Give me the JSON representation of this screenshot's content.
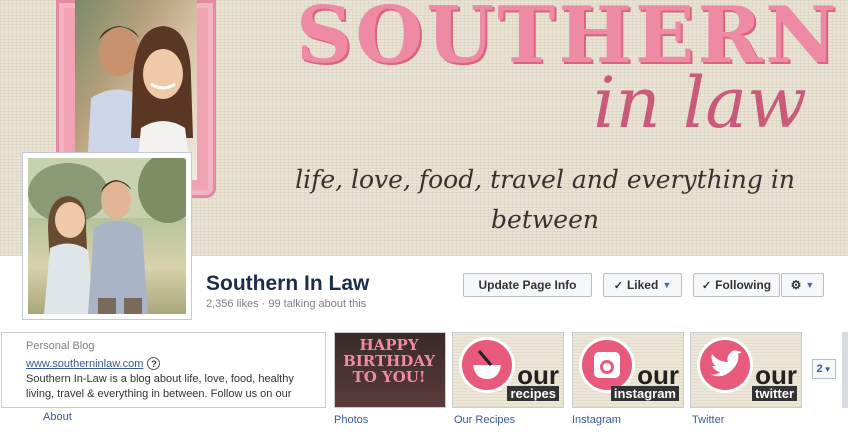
{
  "cover": {
    "title_big": "SOUTHERN",
    "title_small": "in law",
    "tagline": "life, love, food, travel and everything in between",
    "colors": {
      "pink": "#ee8aa3",
      "dark_pink": "#c95a7a",
      "linen": "#e9e3d3"
    }
  },
  "page": {
    "name": "Southern In Law",
    "stats": "2,356 likes · 99 talking about this"
  },
  "actions": {
    "update": "Update Page Info",
    "liked": "Liked",
    "following": "Following",
    "gear_icon": "gear-icon",
    "caret_icon": "caret-down-icon",
    "check_icon": "check-icon"
  },
  "about": {
    "category": "Personal Blog",
    "website": "www.southerninlaw.com",
    "help": "?",
    "description": "Southern In-Law is a blog about life, love, food, healthy living, travel & everything in between. Follow us on our",
    "label": "About"
  },
  "apps": {
    "photos": {
      "label": "Photos",
      "line1": "HAPPY",
      "line2": "BIRTHDAY",
      "line3": "TO YOU!"
    },
    "recipes": {
      "label": "Our Recipes",
      "word1": "our",
      "word2": "recipes"
    },
    "instagram": {
      "label": "Instagram",
      "word1": "our",
      "word2": "instagram"
    },
    "twitter": {
      "label": "Twitter",
      "word1": "our",
      "word2": "twitter"
    },
    "more_count": "2"
  }
}
